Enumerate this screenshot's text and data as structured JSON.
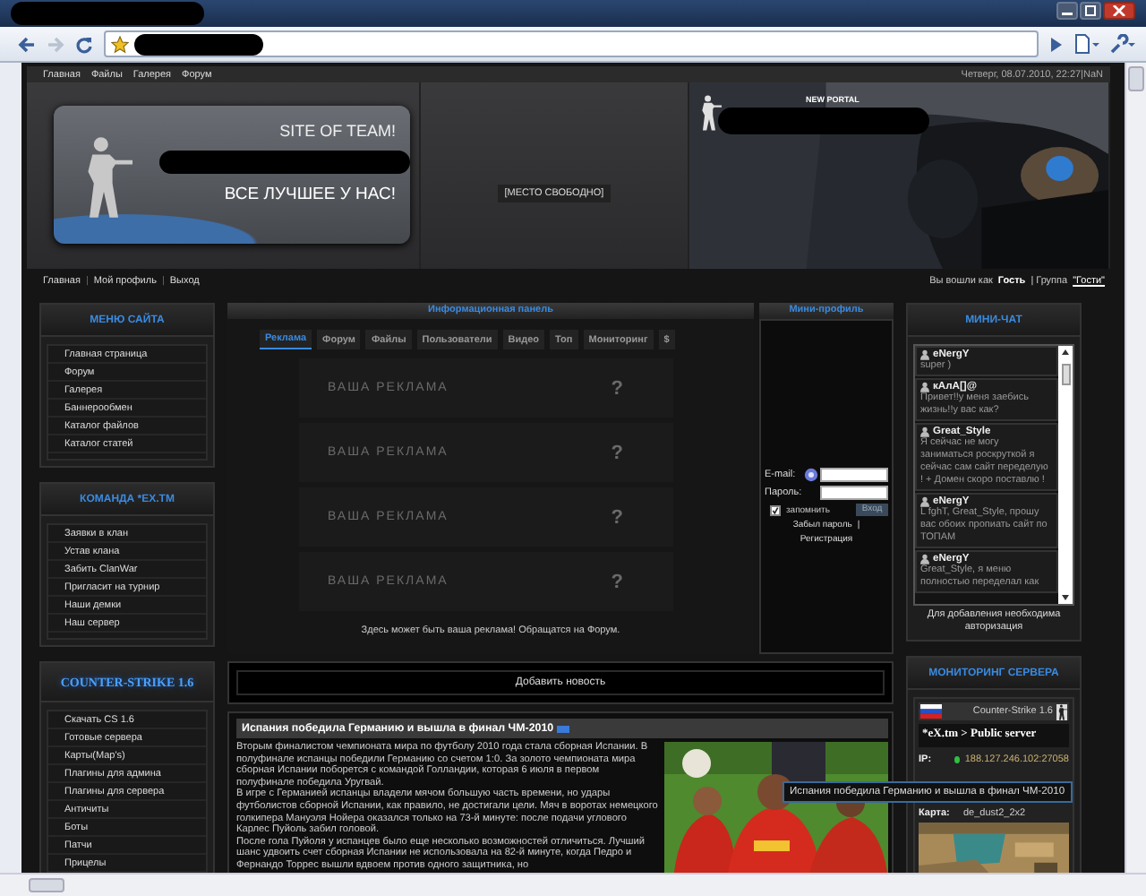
{
  "top_nav": {
    "links": [
      "Главная",
      "Файлы",
      "Галерея",
      "Форум"
    ],
    "date": "Четверг, 08.07.2010, 22:27|NaN"
  },
  "header": {
    "logo_title": "SITE OF TEAM!",
    "logo_slogan": "ВСЕ ЛУЧШЕЕ У НАС!",
    "ad_slot": "[МЕСТО СВОБОДНО]",
    "banner_label": "NEW PORTAL"
  },
  "user_nav": {
    "links": [
      "Главная",
      "Мой профиль",
      "Выход"
    ],
    "separator": "|",
    "login_prefix": "Вы вошли как",
    "user": "Гость",
    "group_prefix": "| Группа",
    "group": "\"Гости\""
  },
  "menus": [
    {
      "title": "МЕНЮ САЙТА",
      "kind": "plain",
      "items": [
        "Главная страница",
        "Форум",
        "Галерея",
        "Баннерообмен",
        "Каталог файлов",
        "Каталог статей"
      ]
    },
    {
      "title": "КОМАНДА *EX.TM",
      "kind": "plain",
      "items": [
        "Заявки в клан",
        "Устав клана",
        "Забить ClanWar",
        "Пригласит на турнир",
        "Наши демки",
        "Наш сервер"
      ]
    },
    {
      "title": "COUNTER-STRIKE 1.6",
      "kind": "glow",
      "items": [
        "Скачать CS 1.6",
        "Готовые сервера",
        "Карты(Map's)",
        "Плагины для админа",
        "Плагины для сервера",
        "Античиты",
        "Боты",
        "Патчи",
        "Прицелы"
      ]
    }
  ],
  "info_panel": {
    "title": "Информационная панель",
    "tabs": [
      {
        "label": "Реклама",
        "selected": true
      },
      {
        "label": "Форум",
        "selected": false
      },
      {
        "label": "Файлы",
        "selected": false
      },
      {
        "label": "Пользователи",
        "selected": false
      },
      {
        "label": "Видео",
        "selected": false
      },
      {
        "label": "Топ",
        "selected": false
      },
      {
        "label": "Мониторинг",
        "selected": false
      },
      {
        "label": "$",
        "selected": false
      }
    ],
    "banners": [
      {
        "text": "ВАША РЕКЛАМА",
        "mark": "?"
      },
      {
        "text": "ВАША РЕКЛАМА",
        "mark": "?"
      },
      {
        "text": "ВАША РЕКЛАМА",
        "mark": "?"
      },
      {
        "text": "ВАША РЕКЛАМА",
        "mark": "?"
      }
    ],
    "footer_text": "Здесь может быть ваша реклама! Обращатся на Форум."
  },
  "mini_profile": {
    "title": "Мини-профиль",
    "email_label": "E-mail:",
    "password_label": "Пароль:",
    "remember": {
      "label": "запомнить",
      "checked": true
    },
    "login_button": "Вход",
    "forgot": "Забыл пароль",
    "separator": "|",
    "register": "Регистрация"
  },
  "add_news": "Добавить новость",
  "news": {
    "title": "Испания победила Германию и вышла в финал ЧМ-2010",
    "paragraphs": [
      "Вторым финалистом чемпионата мира по футболу 2010 года стала сборная Испании. В полуфинале испанцы победили Германию со счетом 1:0. За золото чемпионата мира сборная Испании поборется с командой Голландии, которая 6 июля в первом полуфинале победила Уругвай.",
      "В игре с Германией испанцы владели мячом большую часть времени, но удары футболистов сборной Испании, как правило, не достигали цели. Мяч в воротах немецкого голкипера Мануэля Нойера оказался только на 73-й минуте: после подачи углового Карлес Пуйоль забил головой.",
      "После гола Пуйоля у испанцев было еще несколько возможностей отличиться. Лучший шанс удвоить счет сборная Испании не использовала на 82-й минуте, когда Педро и Фернандо Торрес вышли вдвоем против одного защитника, но"
    ]
  },
  "tooltip": "Испания победила Германию и вышла в финал ЧМ-2010",
  "mini_chat": {
    "title": "МИНИ-ЧАТ",
    "messages": [
      {
        "author": "eNergY",
        "text": "super )"
      },
      {
        "author": "кАлА[]@",
        "text": "Привет!!у меня заебись жизнь!!у вас как?"
      },
      {
        "author": "Great_Style",
        "text": "Я сейчас не могу заниматься роскруткой я сейчас сам сайт переделую ! + Домен скоро поставлю !"
      },
      {
        "author": "eNergY",
        "text": "L fghT, Great_Style, прошу вас обоих пропиать сайт по ТОПАМ"
      },
      {
        "author": "eNergY",
        "text": "Great_Style, я меню полностью переделал как"
      }
    ],
    "notice": "Для добавления необходима авторизация"
  },
  "server_monitor": {
    "title": "МОНИТОРИНГ СЕРВЕРА",
    "game": "Counter-Strike 1.6",
    "name": "*eX.tm > Public server",
    "ip_label": "IP:",
    "online": true,
    "ip": "188.127.246.102:27058",
    "map_label": "Карта:",
    "map": "de_dust2_2x2"
  }
}
